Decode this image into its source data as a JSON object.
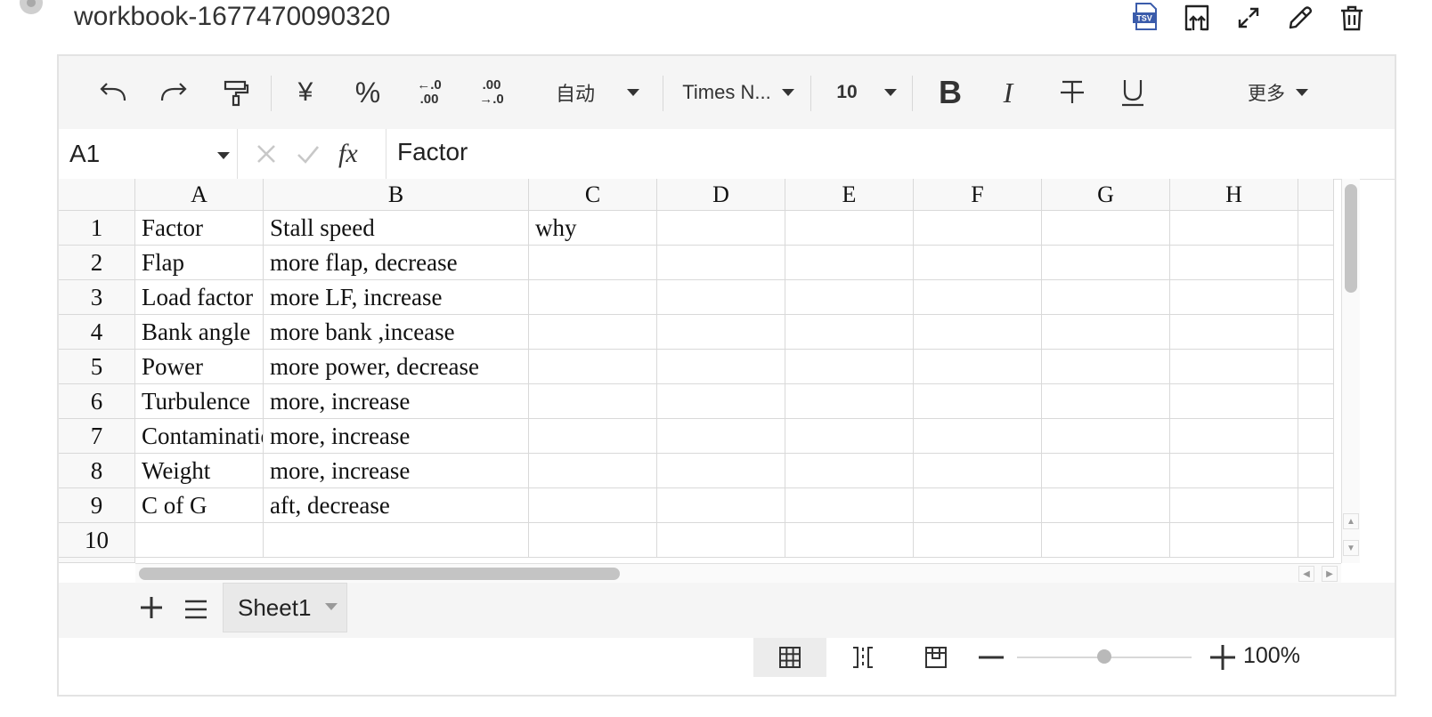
{
  "header": {
    "title": "workbook-1677470090320",
    "icons": [
      "tsv-export-icon",
      "upload-icon",
      "fullscreen-icon",
      "edit-icon",
      "delete-icon"
    ],
    "tsv_badge": "TSV"
  },
  "toolbar": {
    "currency_symbol": "¥",
    "percent_symbol": "%",
    "number_format": "自动",
    "font_family": "Times N...",
    "font_size": "10",
    "bold_label": "B",
    "italic_label": "I",
    "more_label": "更多",
    "decrease_decimal_top": "←.0",
    "decrease_decimal_bottom": ".00",
    "increase_decimal_top": ".00",
    "increase_decimal_bottom": "→.0"
  },
  "formula_bar": {
    "cell_ref": "A1",
    "fx_label": "fx",
    "value": "Factor"
  },
  "grid": {
    "columns": [
      "A",
      "B",
      "C",
      "D",
      "E",
      "F",
      "G",
      "H"
    ],
    "rows": [
      "1",
      "2",
      "3",
      "4",
      "5",
      "6",
      "7",
      "8",
      "9",
      "10"
    ],
    "cells": [
      [
        "Factor",
        "Stall speed",
        "why",
        "",
        "",
        "",
        "",
        ""
      ],
      [
        "Flap",
        "more flap, decrease",
        "",
        "",
        "",
        "",
        "",
        ""
      ],
      [
        "Load factor",
        "more LF, increase",
        "",
        "",
        "",
        "",
        "",
        ""
      ],
      [
        "Bank angle",
        "more bank ,incease",
        "",
        "",
        "",
        "",
        "",
        ""
      ],
      [
        "Power",
        "more power, decrease",
        "",
        "",
        "",
        "",
        "",
        ""
      ],
      [
        "Turbulence",
        "more, increase",
        "",
        "",
        "",
        "",
        "",
        ""
      ],
      [
        "Contaminatic",
        "more, increase",
        "",
        "",
        "",
        "",
        "",
        ""
      ],
      [
        "Weight",
        "more, increase",
        "",
        "",
        "",
        "",
        "",
        ""
      ],
      [
        "C of G",
        "aft, decrease",
        "",
        "",
        "",
        "",
        "",
        ""
      ],
      [
        "",
        "",
        "",
        "",
        "",
        "",
        "",
        ""
      ]
    ]
  },
  "sheets": {
    "tabs": [
      "Sheet1"
    ]
  },
  "status": {
    "zoom": "100%",
    "zoom_level": 0.5
  },
  "colors": {
    "toolbar_bg": "#f5f5f5",
    "header_bg": "#f8f8f8",
    "grid_line": "#d9d9d9",
    "tsv_badge": "#3b5cab"
  }
}
